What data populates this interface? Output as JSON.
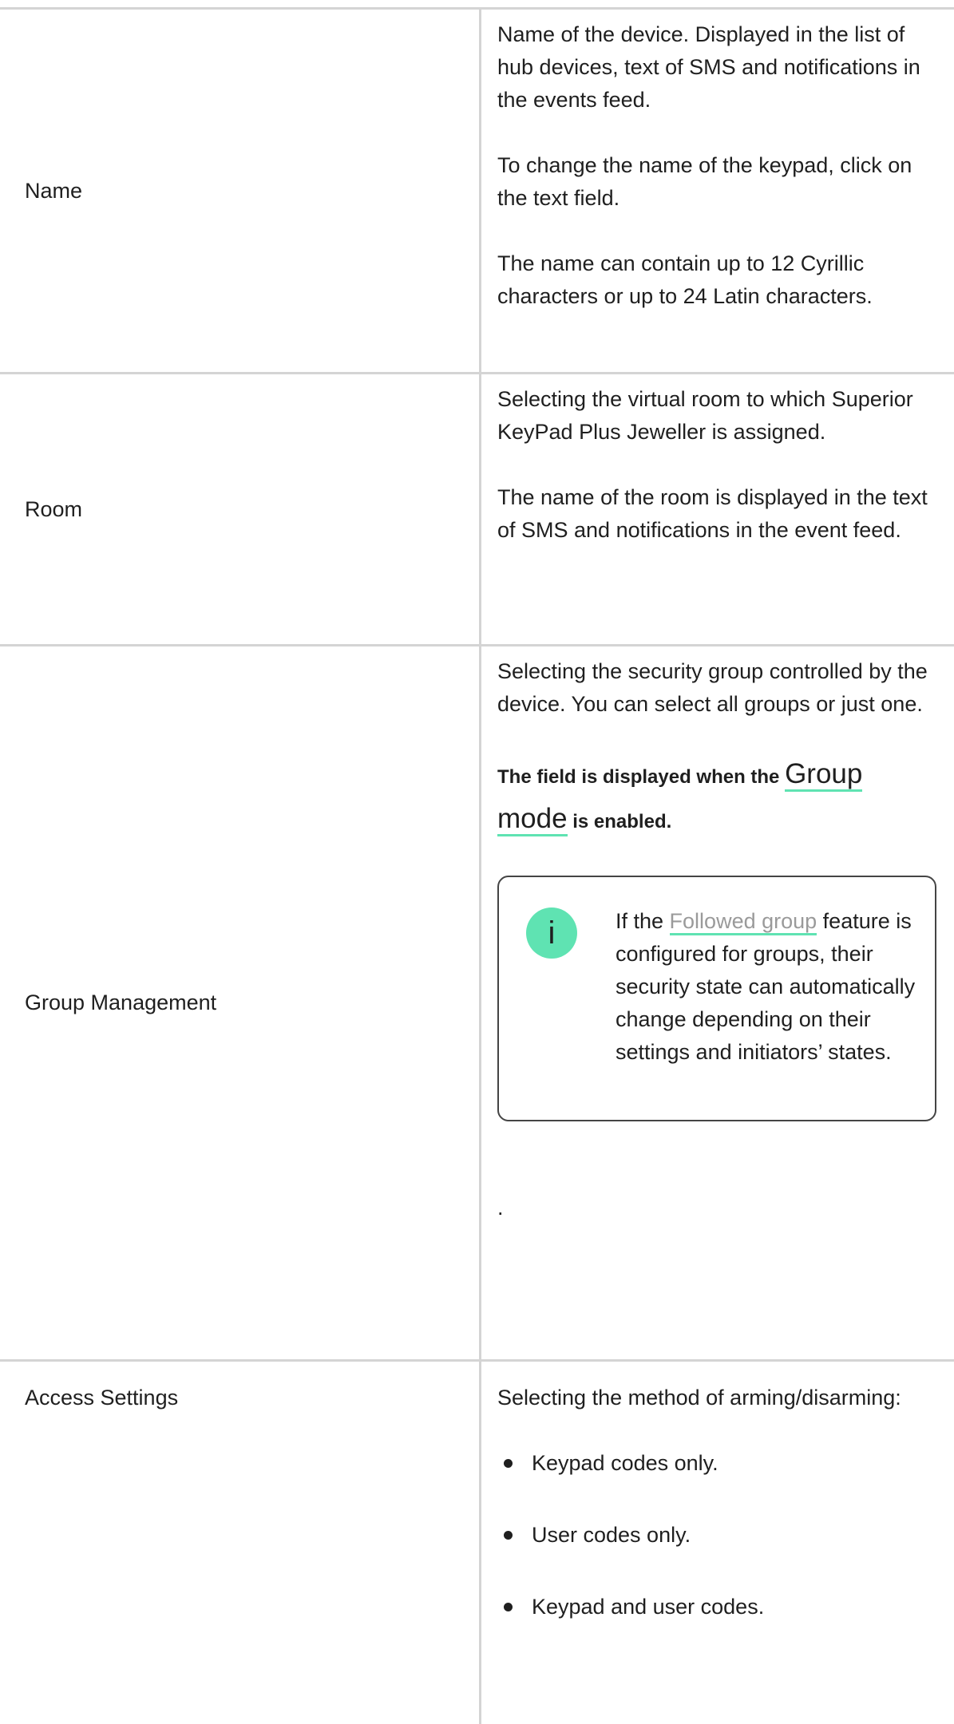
{
  "rows": [
    {
      "label": "Name",
      "paragraphs": [
        "Name of the device. Displayed in the list of hub devices, text of SMS and notifications in the events feed.",
        "To change the name of the keypad, click on the text field.",
        "The name can contain up to 12 Cyrillic characters or up to 24 Latin characters."
      ]
    },
    {
      "label": "Room",
      "paragraphs": [
        "Selecting the virtual room to which Superior KeyPad Plus Jeweller is assigned.",
        "The name of the room is displayed in the text of SMS and notifications in the event feed."
      ]
    },
    {
      "label": "Group Management",
      "paragraphs": [
        "Selecting the security group controlled by the device. You can select all groups or just one."
      ],
      "note": {
        "prefix": "The field is displayed when the ",
        "link": "Group mode",
        "suffix": " is enabled."
      },
      "info": {
        "icon": "i",
        "text_before": "If the ",
        "link": "Followed group",
        "text_after": " feature is configured for groups, their security state can automatically change depending on their settings and initiators’ states."
      },
      "trailing": "."
    },
    {
      "label": "Access Settings",
      "intro": "Selecting the method of arming/disarming:",
      "items": [
        "Keypad codes only.",
        "User codes only.",
        "Keypad and user codes."
      ]
    }
  ],
  "colors": {
    "accent": "#5fe3b2",
    "border": "#d4d4d4",
    "muted_link": "#9a9a9a",
    "text": "#1f1f1f"
  }
}
